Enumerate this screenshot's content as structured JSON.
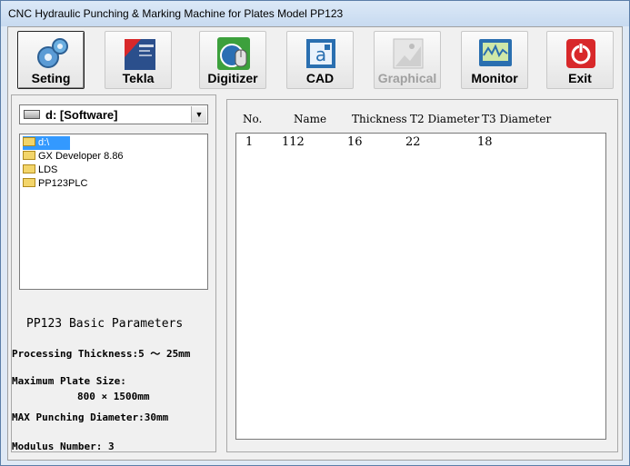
{
  "window": {
    "title": "CNC Hydraulic Punching & Marking Machine for Plates Model PP123"
  },
  "toolbar": {
    "buttons": [
      {
        "label": "Seting",
        "icon": "gears-icon",
        "state": "active"
      },
      {
        "label": "Tekla",
        "icon": "tekla-icon",
        "state": "normal"
      },
      {
        "label": "Digitizer",
        "icon": "digitizer-icon",
        "state": "normal"
      },
      {
        "label": "CAD",
        "icon": "cad-icon",
        "state": "normal"
      },
      {
        "label": "Graphical",
        "icon": "graphical-icon",
        "state": "disabled"
      },
      {
        "label": "Monitor",
        "icon": "monitor-icon",
        "state": "normal"
      },
      {
        "label": "Exit",
        "icon": "power-icon",
        "state": "normal"
      }
    ]
  },
  "drive": {
    "selected": "d: [Software]"
  },
  "folders": [
    {
      "name": "d:\\",
      "selected": true
    },
    {
      "name": "GX Developer 8.86",
      "selected": false
    },
    {
      "name": "LDS",
      "selected": false
    },
    {
      "name": "PP123PLC",
      "selected": false
    }
  ],
  "params": {
    "title": "PP123 Basic Parameters",
    "thickness": "Processing Thickness:5 ～ 25mm",
    "plate_size_label": "Maximum Plate Size:",
    "plate_size_value": "800 × 1500mm",
    "punch_diameter": "MAX Punching Diameter:30mm",
    "modulus": "Modulus Number: 3"
  },
  "table": {
    "headers": [
      "No.",
      "Name",
      "Thickness",
      "T2 Diameter",
      "T3 Diameter"
    ],
    "rows": [
      [
        "1",
        "112",
        "16",
        "22",
        "18"
      ]
    ]
  },
  "colors": {
    "selection": "#3399ff",
    "exit_red": "#d8282a",
    "titlebar": "#c7daf0"
  }
}
